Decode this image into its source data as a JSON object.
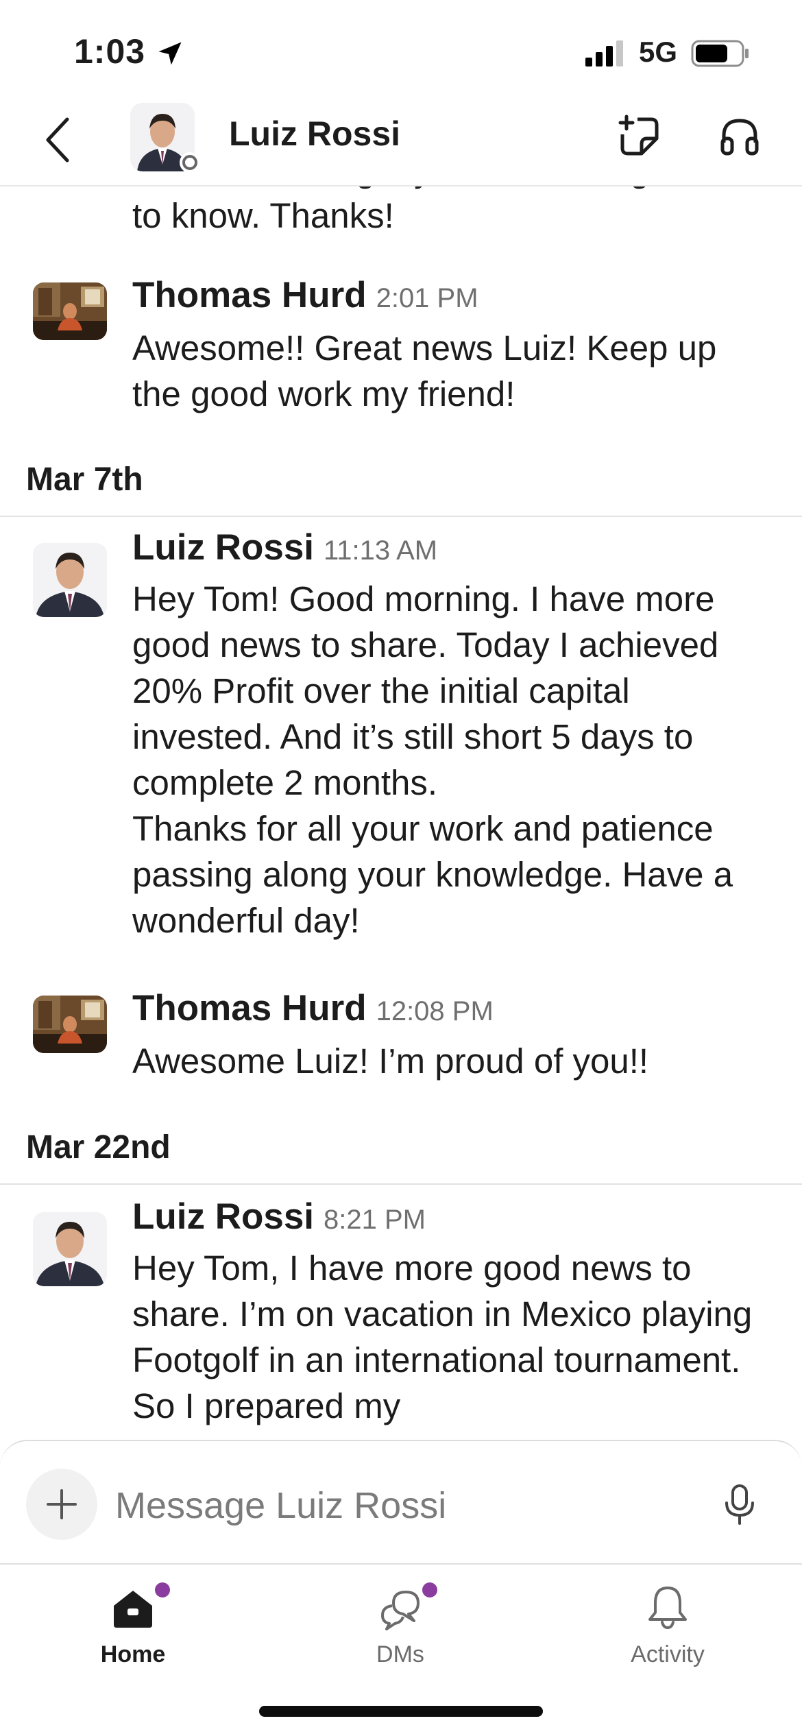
{
  "status_bar": {
    "time": "1:03",
    "network": "5G"
  },
  "header": {
    "title": "Luiz Rossi"
  },
  "partial_message": {
    "lines": [
      "amount. I thought you would be glad",
      "to know. Thanks!"
    ]
  },
  "messages": [
    {
      "author": "Thomas Hurd",
      "time": "2:01 PM",
      "text": "Awesome!!  Great news Luiz!  Keep up the good work my friend!"
    },
    {
      "author": "Luiz Rossi",
      "time": "11:13 AM",
      "text": "Hey Tom! Good morning. I have more good news to share. Today I achieved 20% Profit over the initial capital invested. And it’s still short 5 days to complete 2 months.\nThanks for all your work and patience passing along your knowledge. Have a wonderful day!"
    },
    {
      "author": "Thomas Hurd",
      "time": "12:08 PM",
      "text": "Awesome Luiz!  I’m proud of you!!"
    },
    {
      "author": "Luiz Rossi",
      "time": "8:21 PM",
      "text": "Hey Tom, I have more good news to share. I’m on vacation in Mexico playing Footgolf in an international tournament. So I prepared my"
    }
  ],
  "day_separators": [
    "Mar 7th",
    "Mar 22nd"
  ],
  "composer": {
    "placeholder": "Message Luiz Rossi"
  },
  "tabs": [
    {
      "label": "Home",
      "icon": "home-icon",
      "active": true,
      "badge": true
    },
    {
      "label": "DMs",
      "icon": "dms-icon",
      "active": false,
      "badge": true
    },
    {
      "label": "Activity",
      "icon": "bell-icon",
      "active": false,
      "badge": false
    }
  ],
  "colors": {
    "badge": "#8a3d9f",
    "text": "#1d1c1d",
    "muted": "#6f6f6f"
  }
}
